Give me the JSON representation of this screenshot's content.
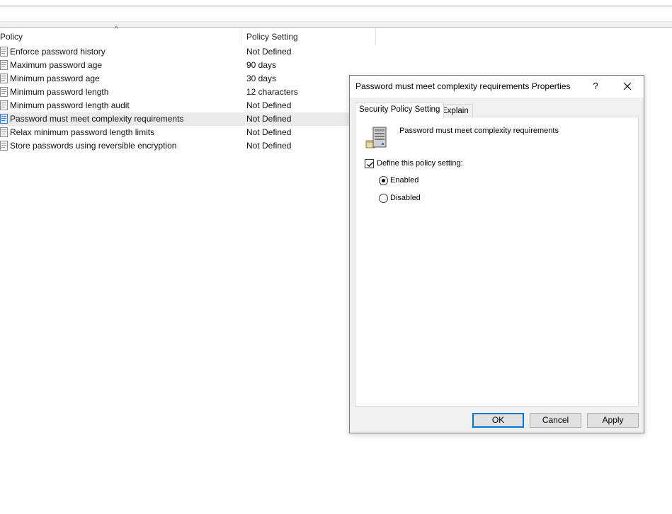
{
  "list": {
    "columns": {
      "policy": "Policy",
      "setting": "Policy Setting"
    },
    "sort_indicator": "^",
    "rows": [
      {
        "name": "Enforce password history",
        "value": "Not Defined"
      },
      {
        "name": "Maximum password age",
        "value": "90 days"
      },
      {
        "name": "Minimum password age",
        "value": "30 days"
      },
      {
        "name": "Minimum password length",
        "value": "12 characters"
      },
      {
        "name": "Minimum password length audit",
        "value": "Not Defined"
      },
      {
        "name": "Password must meet complexity requirements",
        "value": "Not Defined"
      },
      {
        "name": "Relax minimum password length limits",
        "value": "Not Defined"
      },
      {
        "name": "Store passwords using reversible encryption",
        "value": "Not Defined"
      }
    ],
    "selected_row": "Password must meet complexity requirements"
  },
  "dialog": {
    "title": "Password must meet complexity requirements Properties",
    "help_label": "?",
    "tabs": [
      {
        "label": "Security Policy Setting",
        "active": true
      },
      {
        "label": "Explain",
        "active": false
      }
    ],
    "policy_name": "Password must meet complexity requirements",
    "define_label": "Define this policy setting:",
    "define_checked": true,
    "options": [
      {
        "label": "Enabled",
        "selected": true
      },
      {
        "label": "Disabled",
        "selected": false
      }
    ],
    "buttons": {
      "ok": "OK",
      "cancel": "Cancel",
      "apply": "Apply"
    }
  },
  "colors": {
    "selection": "#ebebeb",
    "dialog_bg": "#f0f0f0",
    "default_button_border": "#0078d7",
    "icon_accent": "#3a7bd5"
  }
}
